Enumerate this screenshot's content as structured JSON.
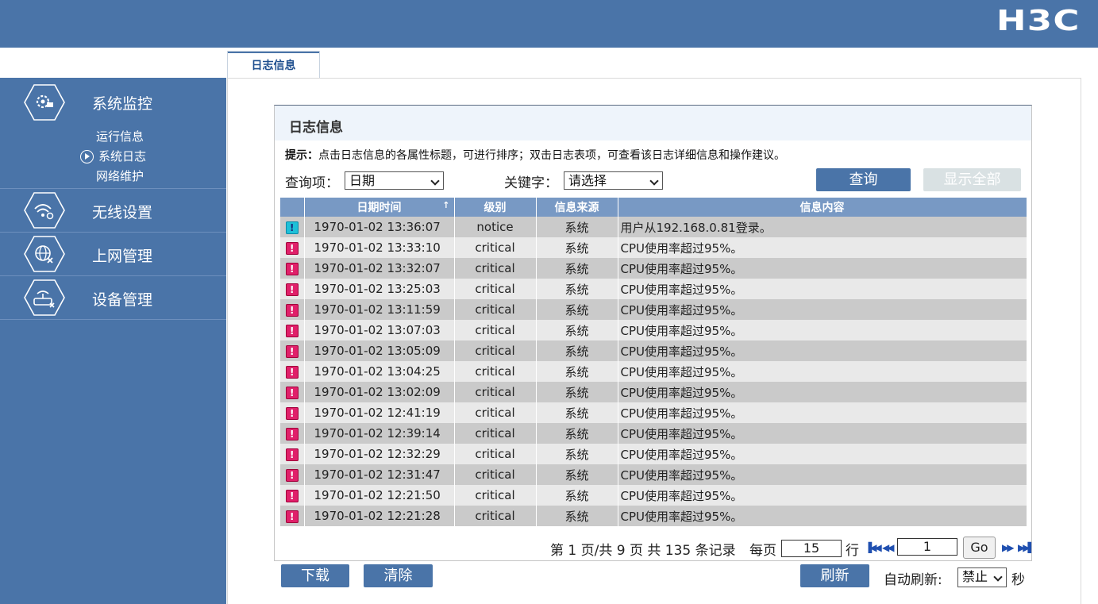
{
  "brand": {
    "logo": "H3C"
  },
  "colors": {
    "primary": "#4a74a8",
    "header_row": "#7899c4",
    "critical": "#e0206a",
    "notice": "#1fc0d8"
  },
  "sidebar": {
    "sections": [
      {
        "label": "系统监控",
        "icon": "monitor-gear-icon",
        "items": [
          {
            "label": "运行信息"
          },
          {
            "label": "系统日志",
            "active": true
          },
          {
            "label": "网络维护"
          }
        ]
      },
      {
        "label": "无线设置",
        "icon": "wifi-gear-icon"
      },
      {
        "label": "上网管理",
        "icon": "globe-block-icon"
      },
      {
        "label": "设备管理",
        "icon": "router-gear-icon"
      }
    ]
  },
  "tab": {
    "label": "日志信息"
  },
  "panel": {
    "title": "日志信息",
    "hint_label": "提示：",
    "hint_text": "点击日志信息的各属性标题，可进行排序；双击日志表项，可查看该日志详细信息和操作建议。",
    "query_label": "查询项：",
    "query_value": "日期",
    "keyword_label": "关键字：",
    "keyword_value": "请选择",
    "query_button": "查询",
    "show_all_button": "显示全部"
  },
  "table": {
    "columns": [
      "",
      "日期时间",
      "级别",
      "信息来源",
      "信息内容"
    ],
    "sort_indicator": "↑",
    "rows": [
      {
        "level_icon": "notice",
        "time": "1970-01-02 13:36:07",
        "level": "notice",
        "source": "系统",
        "message": "用户从192.168.0.81登录。"
      },
      {
        "level_icon": "critical",
        "time": "1970-01-02 13:33:10",
        "level": "critical",
        "source": "系统",
        "message": "CPU使用率超过95%。"
      },
      {
        "level_icon": "critical",
        "time": "1970-01-02 13:32:07",
        "level": "critical",
        "source": "系统",
        "message": "CPU使用率超过95%。"
      },
      {
        "level_icon": "critical",
        "time": "1970-01-02 13:25:03",
        "level": "critical",
        "source": "系统",
        "message": "CPU使用率超过95%。"
      },
      {
        "level_icon": "critical",
        "time": "1970-01-02 13:11:59",
        "level": "critical",
        "source": "系统",
        "message": "CPU使用率超过95%。"
      },
      {
        "level_icon": "critical",
        "time": "1970-01-02 13:07:03",
        "level": "critical",
        "source": "系统",
        "message": "CPU使用率超过95%。"
      },
      {
        "level_icon": "critical",
        "time": "1970-01-02 13:05:09",
        "level": "critical",
        "source": "系统",
        "message": "CPU使用率超过95%。"
      },
      {
        "level_icon": "critical",
        "time": "1970-01-02 13:04:25",
        "level": "critical",
        "source": "系统",
        "message": "CPU使用率超过95%。"
      },
      {
        "level_icon": "critical",
        "time": "1970-01-02 13:02:09",
        "level": "critical",
        "source": "系统",
        "message": "CPU使用率超过95%。"
      },
      {
        "level_icon": "critical",
        "time": "1970-01-02 12:41:19",
        "level": "critical",
        "source": "系统",
        "message": "CPU使用率超过95%。"
      },
      {
        "level_icon": "critical",
        "time": "1970-01-02 12:39:14",
        "level": "critical",
        "source": "系统",
        "message": "CPU使用率超过95%。"
      },
      {
        "level_icon": "critical",
        "time": "1970-01-02 12:32:29",
        "level": "critical",
        "source": "系统",
        "message": "CPU使用率超过95%。"
      },
      {
        "level_icon": "critical",
        "time": "1970-01-02 12:31:47",
        "level": "critical",
        "source": "系统",
        "message": "CPU使用率超过95%。"
      },
      {
        "level_icon": "critical",
        "time": "1970-01-02 12:21:50",
        "level": "critical",
        "source": "系统",
        "message": "CPU使用率超过95%。"
      },
      {
        "level_icon": "critical",
        "time": "1970-01-02 12:21:28",
        "level": "critical",
        "source": "系统",
        "message": "CPU使用率超过95%。"
      }
    ]
  },
  "pager": {
    "summary": "第 1 页/共 9 页  共 135 条记录",
    "per_page_label": "每页",
    "per_page_value": "15",
    "row_unit": "行",
    "page_value": "1",
    "go_button": "Go"
  },
  "footer": {
    "download_button": "下载",
    "clear_button": "清除",
    "refresh_button": "刷新",
    "auto_refresh_label": "自动刷新:",
    "auto_refresh_value": "禁止",
    "seconds_unit": "秒"
  }
}
